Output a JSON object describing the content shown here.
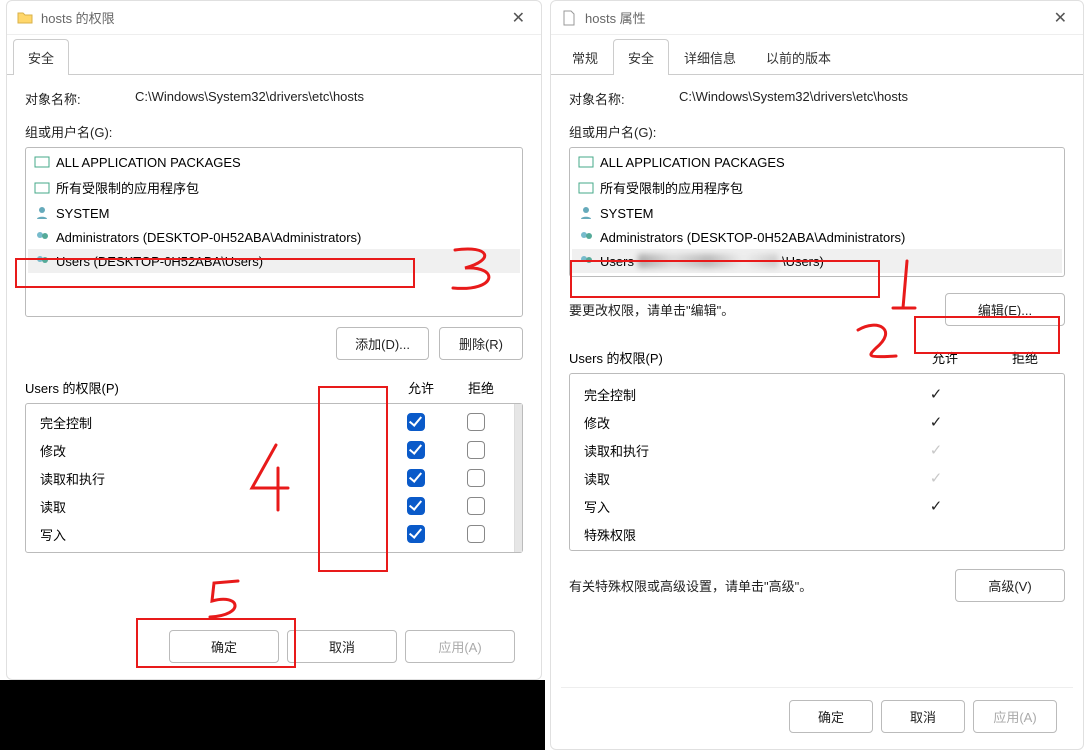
{
  "left": {
    "title": "hosts 的权限",
    "tab_security": "安全",
    "object_label": "对象名称:",
    "object_value": "C:\\Windows\\System32\\drivers\\etc\\hosts",
    "group_label": "组或用户名(G):",
    "items": [
      "ALL APPLICATION PACKAGES",
      "所有受限制的应用程序包",
      "SYSTEM",
      "Administrators (DESKTOP-0H52ABA\\Administrators)",
      "Users (DESKTOP-0H52ABA\\Users)"
    ],
    "btn_add": "添加(D)...",
    "btn_remove": "删除(R)",
    "perm_title": "Users 的权限(P)",
    "col_allow": "允许",
    "col_deny": "拒绝",
    "perms": [
      "完全控制",
      "修改",
      "读取和执行",
      "读取",
      "写入"
    ],
    "btn_ok": "确定",
    "btn_cancel": "取消",
    "btn_apply": "应用(A)"
  },
  "right": {
    "title": "hosts 属性",
    "tabs": [
      "常规",
      "安全",
      "详细信息",
      "以前的版本"
    ],
    "object_label": "对象名称:",
    "object_value": "C:\\Windows\\System32\\drivers\\etc\\hosts",
    "group_label": "组或用户名(G):",
    "items": [
      "ALL APPLICATION PACKAGES",
      "所有受限制的应用程序包",
      "SYSTEM",
      "Administrators (DESKTOP-0H52ABA\\Administrators)"
    ],
    "users_prefix": "Users",
    "users_suffix": "\\Users)",
    "edit_hint": "要更改权限，请单击\"编辑\"。",
    "btn_edit": "编辑(E)...",
    "perm_title": "Users 的权限(P)",
    "col_allow": "允许",
    "col_deny": "拒绝",
    "perms": [
      {
        "name": "完全控制",
        "allow": true,
        "dim": false
      },
      {
        "name": "修改",
        "allow": true,
        "dim": false
      },
      {
        "name": "读取和执行",
        "allow": true,
        "dim": true
      },
      {
        "name": "读取",
        "allow": true,
        "dim": true
      },
      {
        "name": "写入",
        "allow": true,
        "dim": false
      },
      {
        "name": "特殊权限",
        "allow": false,
        "dim": false
      }
    ],
    "advanced_hint": "有关特殊权限或高级设置，请单击\"高级\"。",
    "btn_advanced": "高级(V)",
    "btn_ok": "确定",
    "btn_cancel": "取消",
    "btn_apply": "应用(A)"
  },
  "annotations": {
    "n1": "1",
    "n2": "2",
    "n3": "3",
    "n4": "4",
    "n5": "5"
  }
}
